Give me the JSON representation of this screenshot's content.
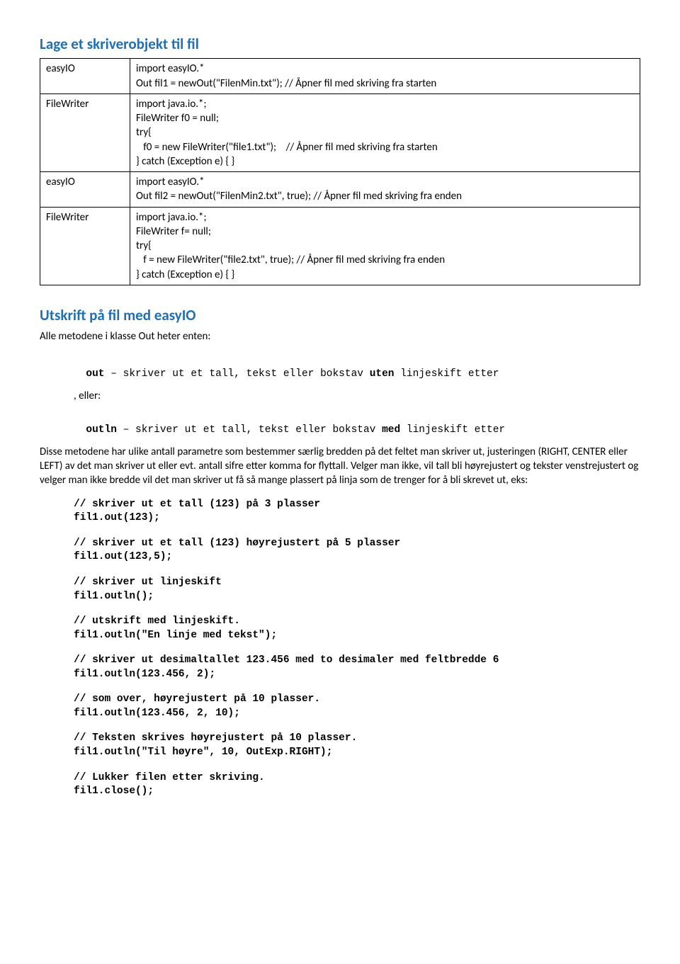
{
  "section1": {
    "title": "Lage et skriverobjekt til fil",
    "rows": [
      {
        "label": "easyIO",
        "code": "import easyIO.*\nOut fil1 = newOut(\"FilenMin.txt\"); // Åpner fil med skriving fra starten"
      },
      {
        "label": "FileWriter",
        "code": "import java.io.*;\nFileWriter f0 = null;\ntry{\n   f0 = new FileWriter(\"file1.txt\");    // Åpner fil med skriving fra starten\n} catch (Exception e) { }"
      },
      {
        "label": "easyIO",
        "code": "import easyIO.*\nOut fil2 = newOut(\"FilenMin2.txt\", true); // Åpner fil med skriving fra enden"
      },
      {
        "label": "FileWriter",
        "code": "import java.io.*;\nFileWriter f= null;\ntry{\n   f = new FileWriter(\"file2.txt\", true); // Åpner fil med skriving fra enden\n} catch (Exception e) { }"
      }
    ]
  },
  "section2": {
    "title": "Utskrift på fil med easyIO",
    "intro": "Alle metodene i klasse Out heter enten:",
    "out_line_prefix": "out",
    "out_line_rest": " – skriver ut et tall, tekst eller bokstav ",
    "out_line_bold2": "uten",
    "out_line_end": " linjeskift etter",
    "eller": ", eller:",
    "outln_line_prefix": "outln",
    "outln_line_rest": " – skriver ut et tall, tekst eller bokstav ",
    "outln_line_bold2": "med",
    "outln_line_end": " linjeskift etter",
    "para": "Disse metodene har ulike antall parametre som bestemmer særlig bredden på det feltet man skriver ut, justeringen (RIGHT, CENTER eller LEFT) av det man skriver ut eller evt. antall sifre etter komma for flyttall. Velger man ikke, vil tall bli høyrejustert og tekster venstrejustert og velger man ikke bredde vil det man skriver ut få så mange plassert på linja som de trenger for å bli skrevet ut, eks:",
    "examples": [
      {
        "comment": "// skriver ut et tall (123) på 3 plasser",
        "stmt": "fil1.out(123);"
      },
      {
        "comment": "// skriver ut et tall (123) høyrejustert på 5 plasser",
        "stmt": "fil1.out(123,5);"
      },
      {
        "comment": "// skriver ut linjeskift",
        "stmt": "fil1.outln();"
      },
      {
        "comment": "// utskrift med linjeskift.",
        "stmt": "fil1.outln(\"En linje med tekst\");"
      },
      {
        "comment": "// skriver ut desimaltallet 123.456 med to desimaler med feltbredde 6",
        "stmt": "fil1.outln(123.456, 2);"
      },
      {
        "comment": "// som over, høyrejustert på 10 plasser.",
        "stmt": "fil1.outln(123.456, 2, 10);"
      },
      {
        "comment": "// Teksten skrives høyrejustert på 10 plasser.",
        "stmt": "fil1.outln(\"Til høyre\", 10, OutExp.RIGHT);"
      },
      {
        "comment": "// Lukker filen etter skriving.",
        "stmt": "fil1.close();"
      }
    ]
  }
}
